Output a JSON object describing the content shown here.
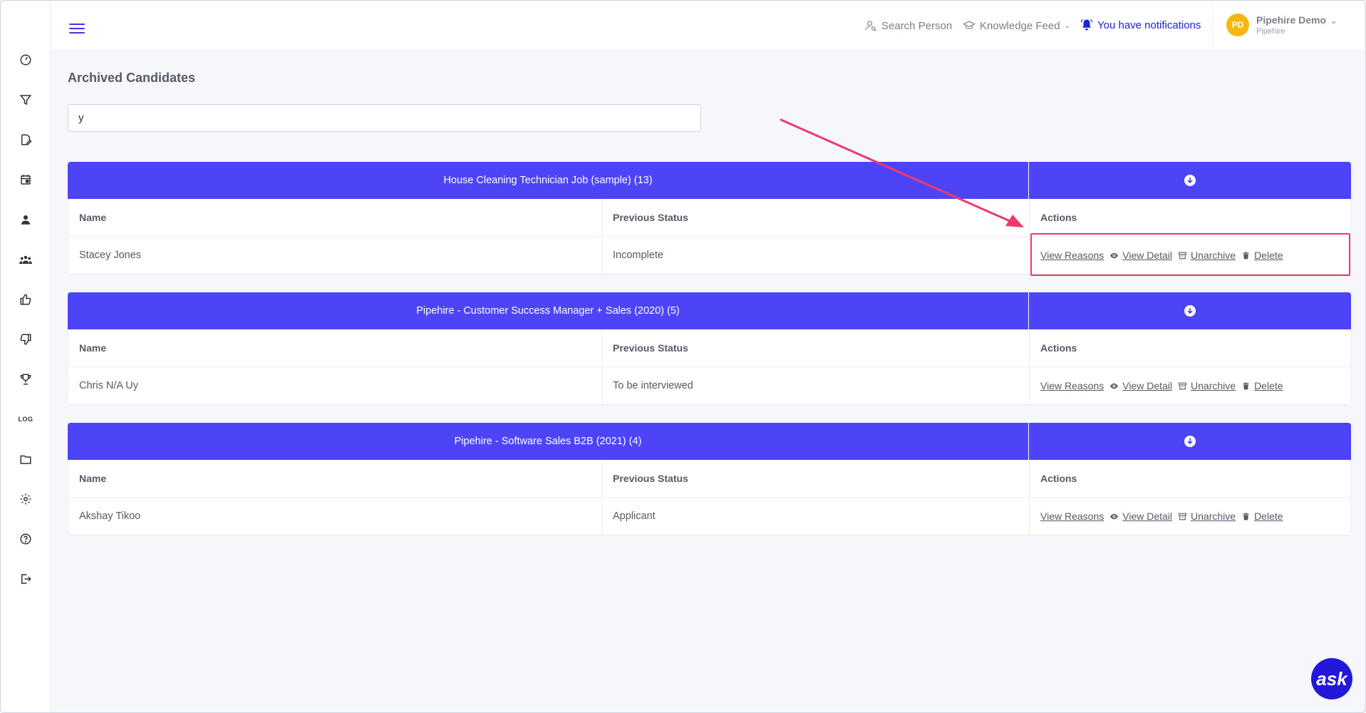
{
  "topbar": {
    "search_person": "Search Person",
    "knowledge_feed": "Knowledge Feed",
    "notifications": "You have notifications",
    "profile_initials": "PD",
    "profile_name": "Pipehire Demo",
    "profile_org": "Pipehire"
  },
  "sidebar": {
    "icons": [
      "dashboard-icon",
      "funnel-icon",
      "edit-document-icon",
      "calendar-icon",
      "person-icon",
      "team-icon",
      "thumbs-up-icon",
      "thumbs-down-icon",
      "trophy-icon",
      "log-icon",
      "folder-icon",
      "settings-icon",
      "help-icon",
      "logout-icon"
    ],
    "log_label": "LOG"
  },
  "page": {
    "title": "Archived Candidates",
    "search_value": "y"
  },
  "columns": {
    "name": "Name",
    "previous_status": "Previous Status",
    "actions": "Actions"
  },
  "actions": {
    "view_reasons": "View Reasons",
    "view_detail": "View Detail",
    "unarchive": "Unarchive",
    "delete": "Delete"
  },
  "jobs": [
    {
      "title": "House Cleaning Technician Job (sample) (13)",
      "candidates": [
        {
          "name": "Stacey Jones",
          "status": "Incomplete"
        }
      ]
    },
    {
      "title": "Pipehire - Customer Success Manager + Sales (2020) (5)",
      "candidates": [
        {
          "name": "Chris N/A Uy",
          "status": "To be interviewed"
        }
      ]
    },
    {
      "title": "Pipehire - Software Sales B2B (2021) (4)",
      "candidates": [
        {
          "name": "Akshay Tikoo",
          "status": "Applicant"
        }
      ]
    }
  ],
  "ask_button": "ask",
  "colors": {
    "accent": "#4c44f6",
    "notification": "#1f22d6",
    "avatar": "#f6b80a",
    "annotation": "#ee3a6a"
  }
}
